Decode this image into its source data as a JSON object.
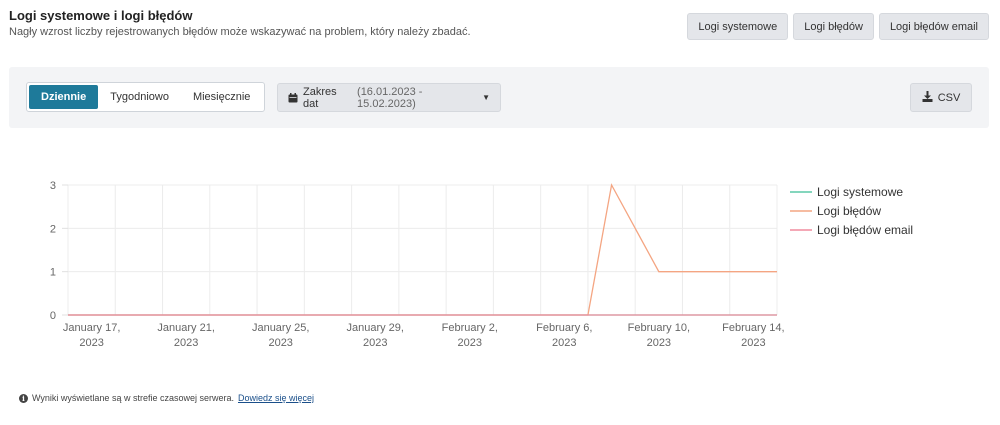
{
  "header": {
    "title": "Logi systemowe i logi błędów",
    "subtitle": "Nagły wzrost liczby rejestrowanych błędów może wskazywać na problem, który należy zbadać."
  },
  "tabs": [
    {
      "label": "Logi systemowe"
    },
    {
      "label": "Logi błędów"
    },
    {
      "label": "Logi błędów email"
    }
  ],
  "toolbar": {
    "periods": [
      {
        "label": "Dziennie",
        "active": true
      },
      {
        "label": "Tygodniowo",
        "active": false
      },
      {
        "label": "Miesięcznie",
        "active": false
      }
    ],
    "date_range_label": "Zakres dat",
    "date_range_value": "(16.01.2023 - 15.02.2023)",
    "csv_label": "CSV"
  },
  "chart_data": {
    "type": "line",
    "x_dates": [
      "2023-01-16",
      "2023-01-17",
      "2023-01-18",
      "2023-01-19",
      "2023-01-20",
      "2023-01-21",
      "2023-01-22",
      "2023-01-23",
      "2023-01-24",
      "2023-01-25",
      "2023-01-26",
      "2023-01-27",
      "2023-01-28",
      "2023-01-29",
      "2023-01-30",
      "2023-01-31",
      "2023-02-01",
      "2023-02-02",
      "2023-02-03",
      "2023-02-04",
      "2023-02-05",
      "2023-02-06",
      "2023-02-07",
      "2023-02-08",
      "2023-02-09",
      "2023-02-10",
      "2023-02-11",
      "2023-02-12",
      "2023-02-13",
      "2023-02-14",
      "2023-02-15"
    ],
    "x_ticks": [
      {
        "line1": "January 17,",
        "line2": "2023"
      },
      {
        "line1": "January 21,",
        "line2": "2023"
      },
      {
        "line1": "January 25,",
        "line2": "2023"
      },
      {
        "line1": "January 29,",
        "line2": "2023"
      },
      {
        "line1": "February 2,",
        "line2": "2023"
      },
      {
        "line1": "February 6,",
        "line2": "2023"
      },
      {
        "line1": "February 10,",
        "line2": "2023"
      },
      {
        "line1": "February 14,",
        "line2": "2023"
      }
    ],
    "tick_dates": [
      "2023-01-17",
      "2023-01-21",
      "2023-01-25",
      "2023-01-29",
      "2023-02-02",
      "2023-02-06",
      "2023-02-10",
      "2023-02-14"
    ],
    "y_ticks": [
      "0",
      "1",
      "2",
      "3"
    ],
    "ylim": [
      0,
      3
    ],
    "grid": true,
    "legend_position": "right",
    "series": [
      {
        "name": "Logi systemowe",
        "color": "#5cc9a7",
        "values": [
          0,
          0,
          0,
          0,
          0,
          0,
          0,
          0,
          0,
          0,
          0,
          0,
          0,
          0,
          0,
          0,
          0,
          0,
          0,
          0,
          0,
          0,
          0,
          0,
          0,
          0,
          0,
          0,
          0,
          0,
          0
        ]
      },
      {
        "name": "Logi błędów",
        "color": "#f4a582",
        "values": [
          0,
          0,
          0,
          0,
          0,
          0,
          0,
          0,
          0,
          0,
          0,
          0,
          0,
          0,
          0,
          0,
          0,
          0,
          0,
          0,
          0,
          0,
          0,
          3,
          2,
          1,
          1,
          1,
          1,
          1,
          1
        ]
      },
      {
        "name": "Logi błędów email",
        "color": "#f08b9e",
        "values": [
          0,
          0,
          0,
          0,
          0,
          0,
          0,
          0,
          0,
          0,
          0,
          0,
          0,
          0,
          0,
          0,
          0,
          0,
          0,
          0,
          0,
          0,
          0,
          0,
          0,
          0,
          0,
          0,
          0,
          0,
          0
        ]
      }
    ]
  },
  "footnote": {
    "text": "Wyniki wyświetlane są w strefie czasowej serwera.",
    "link": "Dowiedz się więcej"
  }
}
